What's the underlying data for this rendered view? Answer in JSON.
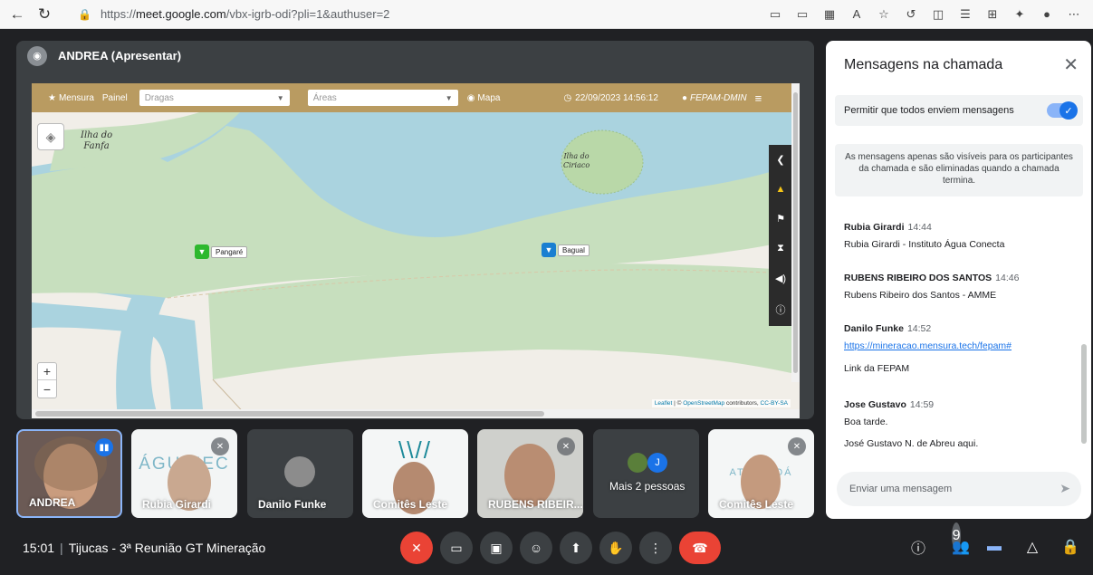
{
  "browser": {
    "url_prefix": "https://",
    "url_host": "meet.google.com",
    "url_path": "/vbx-igrb-odi?pli=1&authuser=2",
    "icons": [
      "camera-icon",
      "cast-icon",
      "apps-icon",
      "read-aloud-icon",
      "favorite-icon",
      "refresh-icon",
      "split-icon",
      "favorites-icon",
      "collections-icon",
      "extensions-icon",
      "profile-icon",
      "more-icon"
    ]
  },
  "presentation": {
    "presenter": "ANDREA (Apresentar)",
    "map_app": {
      "mensura_label": "Mensura",
      "painel_label": "Painel",
      "dragas_placeholder": "Dragas",
      "areas_placeholder": "Áreas",
      "mapa_label": "Mapa",
      "datetime": "22/09/2023 14:56:12",
      "user": "FEPAM-DMIN",
      "island_fanfa": "Ilha do\nFanfa",
      "island_ciriaco": "Ilha do\nCiriaco",
      "marker_pangare": "Pangaré",
      "marker_bagual": "Bagual",
      "attribution_leaflet": "Leaflet",
      "attribution_mid": " | © ",
      "attribution_osm": "OpenStreetMap",
      "attribution_contrib": " contributors, ",
      "attribution_cc": "CC-BY-SA",
      "zoom_in": "+",
      "zoom_out": "−"
    }
  },
  "tiles": [
    {
      "name": "ANDREA"
    },
    {
      "name": "Rubia Girardi"
    },
    {
      "name": "Danilo Funke"
    },
    {
      "name": "Comitês Leste"
    },
    {
      "name": "RUBENS RIBEIR..."
    },
    {
      "name": "Mais 2 pessoas",
      "avatar_letter": "J"
    },
    {
      "name": "Comitês Leste"
    }
  ],
  "bottom": {
    "time": "15:01",
    "meeting_name": "Tijucas - 3ª Reunião GT Mineração",
    "people_count": "9"
  },
  "chat": {
    "title": "Mensagens na chamada",
    "allow_label": "Permitir que todos enviem mensagens",
    "notice": "As mensagens apenas são visíveis para os participantes da chamada e são eliminadas quando a chamada termina.",
    "messages": [
      {
        "sender": "Rubia Girardi",
        "time": "14:44",
        "lines": [
          "Rubia Girardi - Instituto Água Conecta"
        ]
      },
      {
        "sender": "RUBENS RIBEIRO DOS SANTOS",
        "time": "14:46",
        "lines": [
          "Rubens Ribeiro dos Santos - AMME"
        ]
      },
      {
        "sender": "Danilo Funke",
        "time": "14:52",
        "link": "https://mineracao.mensura.tech/fepam#",
        "lines": [
          "Link da FEPAM"
        ]
      },
      {
        "sender": "Jose Gustavo",
        "time": "14:59",
        "lines": [
          "Boa tarde.",
          "José Gustavo N. de Abreu aqui."
        ]
      }
    ],
    "input_placeholder": "Enviar uma mensagem"
  }
}
